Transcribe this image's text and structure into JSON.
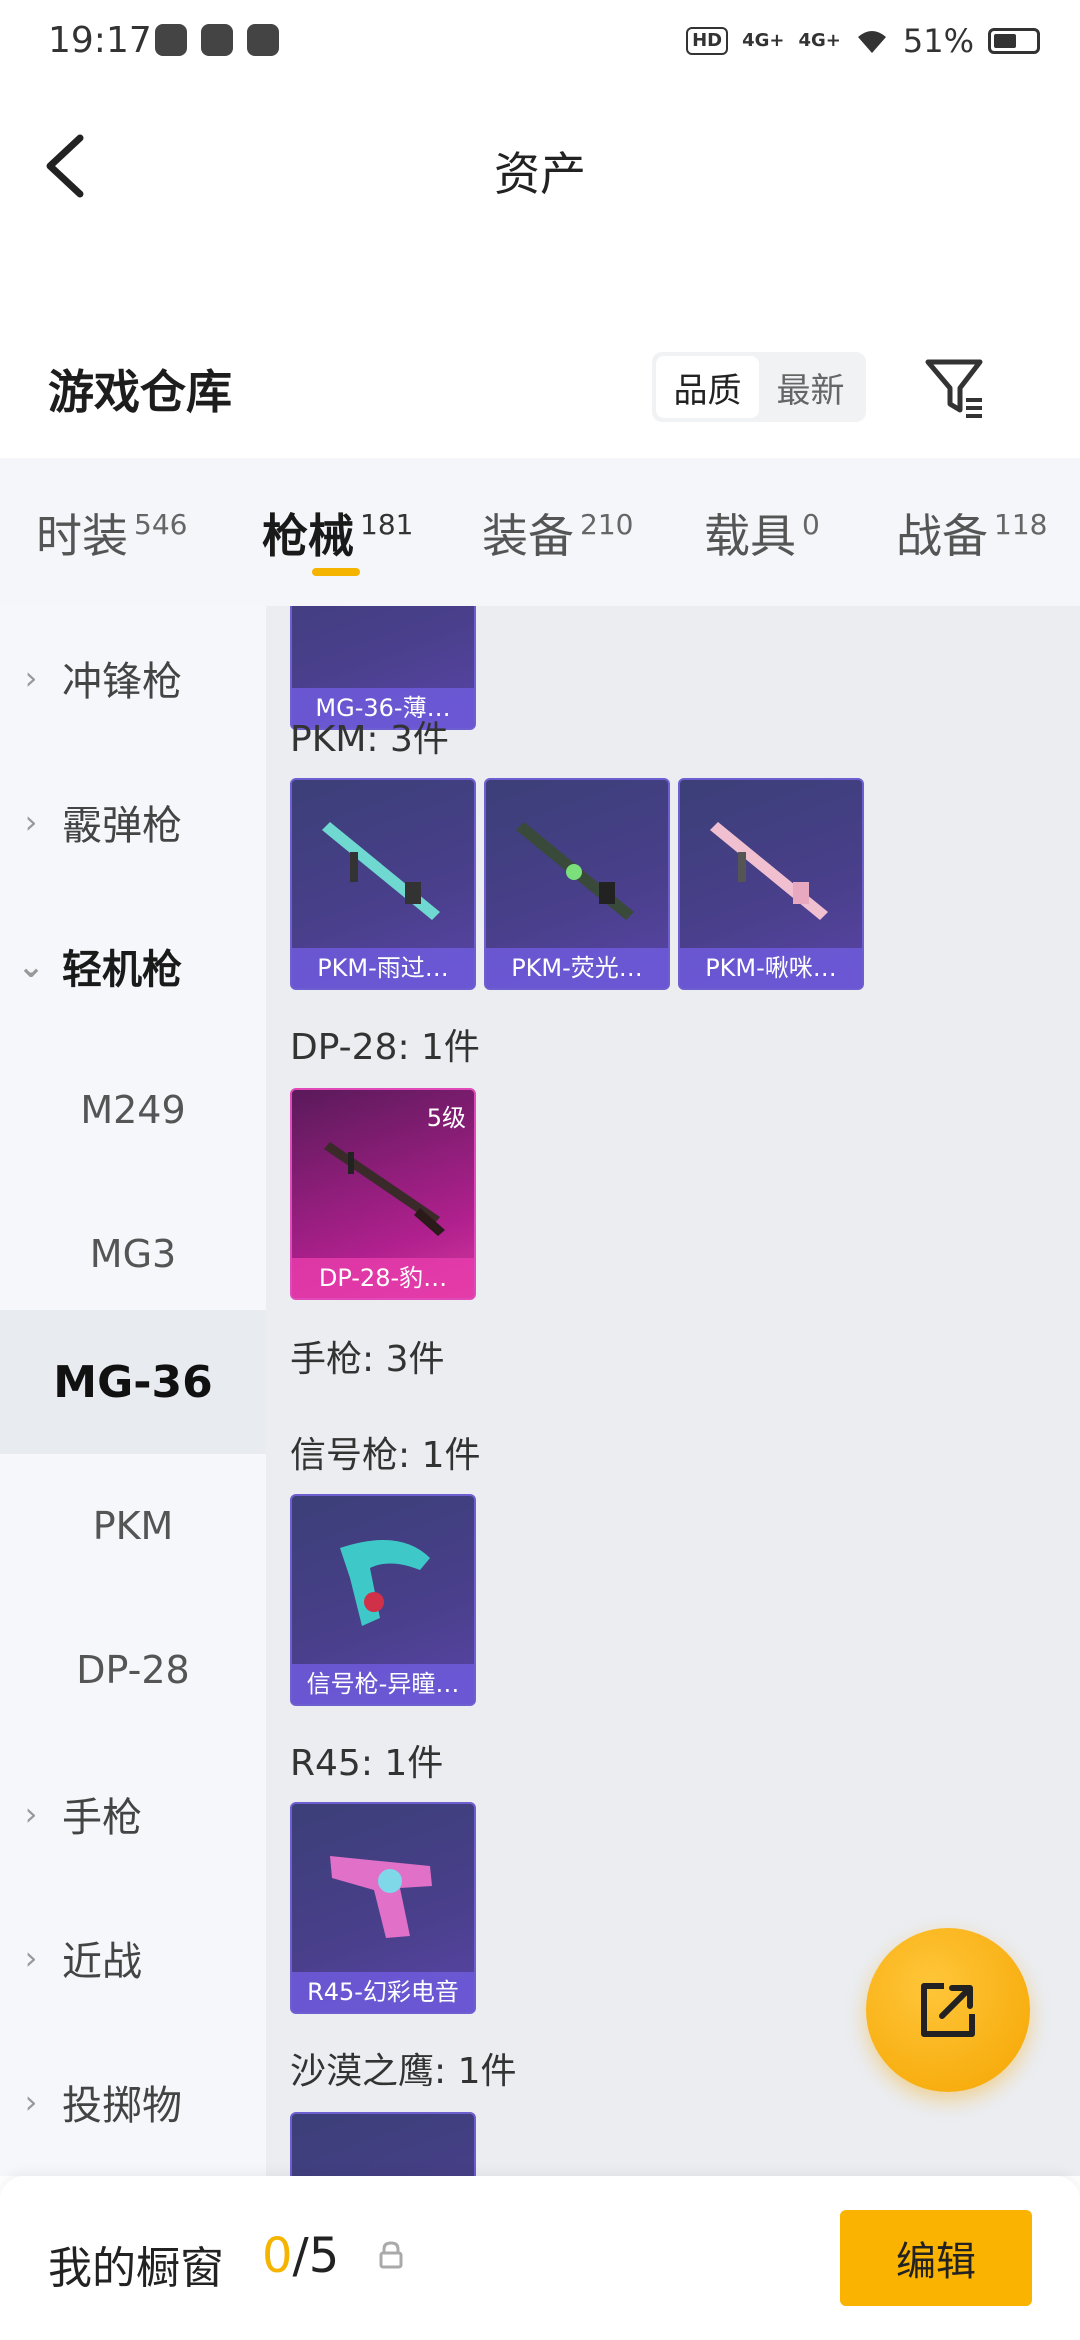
{
  "status_bar": {
    "time": "19:17",
    "hd_label": "HD",
    "signal1": "4G+",
    "signal2": "4G+",
    "battery": "51%"
  },
  "nav": {
    "title": "资产"
  },
  "warehouse": {
    "title": "游戏仓库",
    "sort_options": [
      "品质",
      "最新"
    ],
    "active_sort": "品质"
  },
  "tabs": [
    {
      "label": "时装",
      "count": "546"
    },
    {
      "label": "枪械",
      "count": "181"
    },
    {
      "label": "装备",
      "count": "210"
    },
    {
      "label": "载具",
      "count": "0"
    },
    {
      "label": "战备",
      "count": "118"
    }
  ],
  "active_tab": "枪械",
  "sidebar": {
    "items": [
      {
        "label": "冲锋枪"
      },
      {
        "label": "霰弹枪"
      },
      {
        "label": "轻机枪"
      },
      {
        "label": "M249"
      },
      {
        "label": "MG3"
      },
      {
        "label": "MG-36"
      },
      {
        "label": "PKM"
      },
      {
        "label": "DP-28"
      },
      {
        "label": "手枪"
      },
      {
        "label": "近战"
      },
      {
        "label": "投掷物"
      }
    ],
    "selected": "MG-36"
  },
  "content": {
    "top_card": {
      "name": "MG-36-薄…"
    },
    "groups": [
      {
        "label": "PKM: 3件",
        "cards": [
          {
            "name": "PKM-雨过…"
          },
          {
            "name": "PKM-荧光…"
          },
          {
            "name": "PKM-啾咪…"
          }
        ]
      },
      {
        "label": "DP-28: 1件",
        "cards": [
          {
            "name": "DP-28-豹…",
            "level": "5级"
          }
        ]
      },
      {
        "label": "手枪: 3件"
      },
      {
        "label": "信号枪: 1件",
        "cards": [
          {
            "name": "信号枪-异瞳…"
          }
        ]
      },
      {
        "label": "R45: 1件",
        "cards": [
          {
            "name": "R45-幻彩电音"
          }
        ]
      },
      {
        "label": "沙漠之鹰: 1件"
      }
    ]
  },
  "showcase": {
    "title": "我的橱窗",
    "current": "0",
    "total": "/5",
    "edit_label": "编辑"
  },
  "colors": {
    "accent": "#f5b400",
    "card_purple": "#4a3f8c",
    "card_pink": "#b0208e"
  }
}
